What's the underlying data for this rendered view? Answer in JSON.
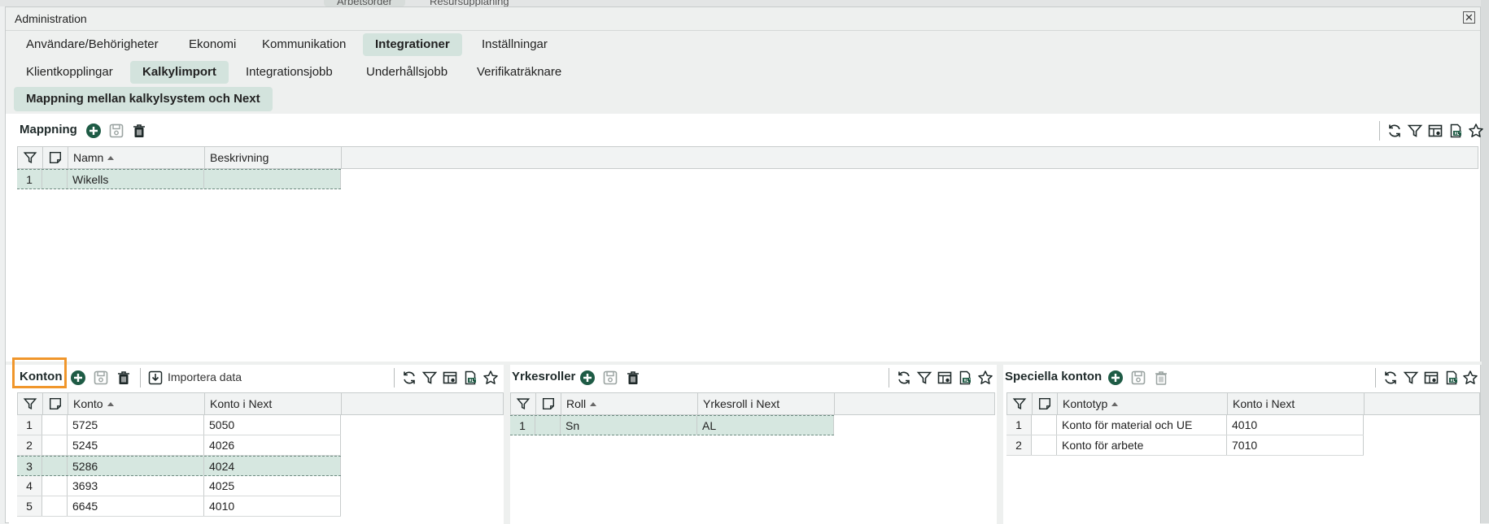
{
  "background_tabs": [
    "Arbetsorder",
    "Resursupplaning"
  ],
  "window": {
    "title": "Administration",
    "close_glyph": "✕"
  },
  "tabs_main": [
    {
      "label": "Användare/Behörigheter",
      "active": false
    },
    {
      "label": "Ekonomi",
      "active": false
    },
    {
      "label": "Kommunikation",
      "active": false
    },
    {
      "label": "Integrationer",
      "active": true
    },
    {
      "label": "Inställningar",
      "active": false
    }
  ],
  "tabs_sub": [
    {
      "label": "Klientkopplingar",
      "active": false
    },
    {
      "label": "Kalkylimport",
      "active": true
    },
    {
      "label": "Integrationsjobb",
      "active": false
    },
    {
      "label": "Underhållsjobb",
      "active": false
    },
    {
      "label": "Verifikaträknare",
      "active": false
    }
  ],
  "subsub_tab": "Mappning mellan kalkylsystem och Next",
  "mappning": {
    "title": "Mappning",
    "columns": [
      "Namn",
      "Beskrivning"
    ],
    "rows": [
      {
        "num": "1",
        "c1": "Wikells",
        "c2": "",
        "selected": true
      }
    ]
  },
  "konton": {
    "title": "Konton",
    "import_label": "Importera data",
    "columns": [
      "Konto",
      "Konto i Next"
    ],
    "rows": [
      {
        "num": "1",
        "c1": "5725",
        "c2": "5050",
        "selected": false
      },
      {
        "num": "2",
        "c1": "5245",
        "c2": "4026",
        "selected": false
      },
      {
        "num": "3",
        "c1": "5286",
        "c2": "4024",
        "selected": true
      },
      {
        "num": "4",
        "c1": "3693",
        "c2": "4025",
        "selected": false
      },
      {
        "num": "5",
        "c1": "6645",
        "c2": "4010",
        "selected": false
      }
    ]
  },
  "yrkesroller": {
    "title": "Yrkesroller",
    "columns": [
      "Roll",
      "Yrkesroll i Next"
    ],
    "rows": [
      {
        "num": "1",
        "c1": "Sn",
        "c2": "AL",
        "selected": true
      }
    ]
  },
  "speciella": {
    "title": "Speciella konton",
    "columns": [
      "Kontotyp",
      "Konto i Next"
    ],
    "rows": [
      {
        "num": "1",
        "c1": "Konto för material och UE",
        "c2": "4010",
        "selected": false
      },
      {
        "num": "2",
        "c1": "Konto för arbete",
        "c2": "7010",
        "selected": false
      }
    ]
  },
  "colors": {
    "accent_green": "#1e5b45",
    "active_tab_bg": "#d3e3dd",
    "selected_row_bg": "#d6e7e0",
    "highlight_orange": "#f0962b"
  }
}
